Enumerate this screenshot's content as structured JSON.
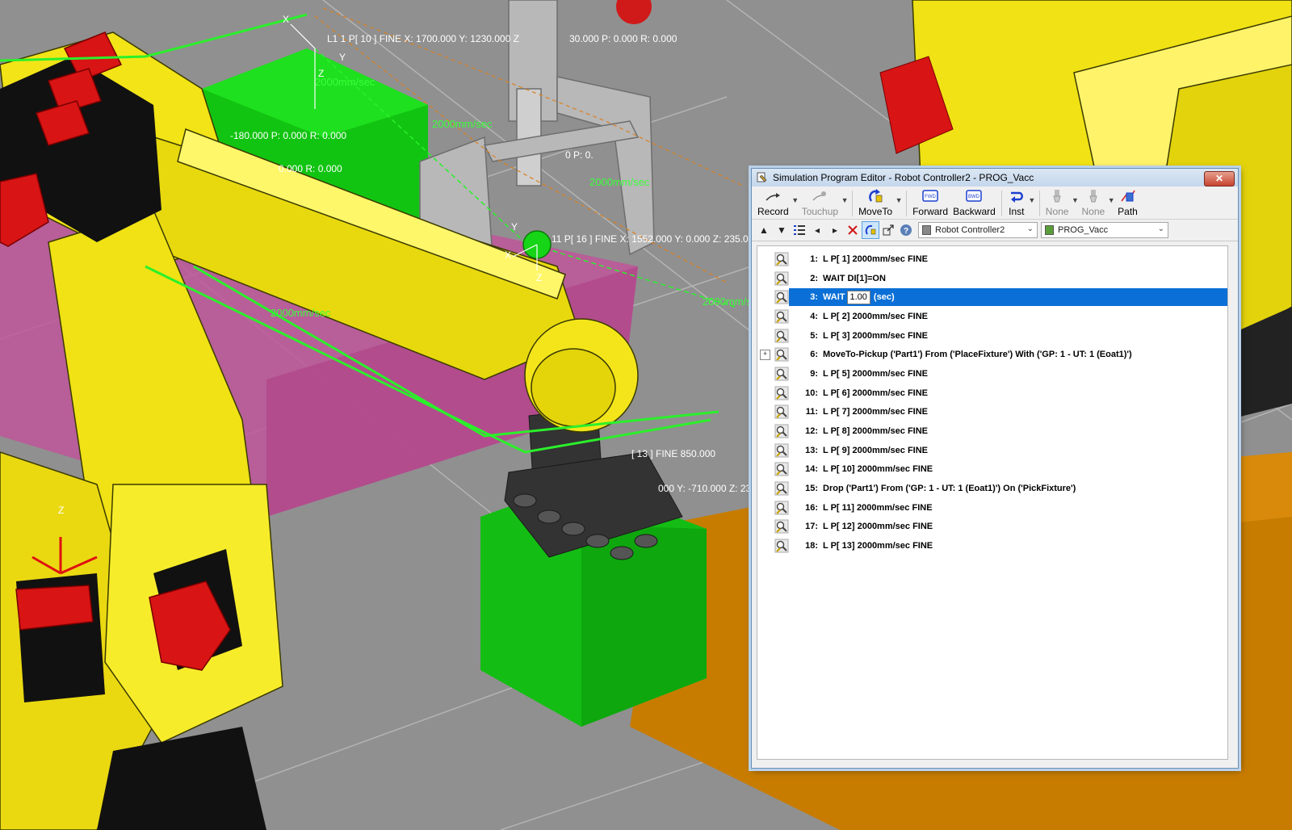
{
  "scene": {
    "labels": {
      "top_left_pose": "L1 1 P[ 10 ]   FINE X: 1700.000 Y: 1230.000 Z",
      "top_right_pose": "30.000 P: 0.000 R: 0.000",
      "mid_pose_1": "-180.000 P: 0.000 R: 0.000",
      "mid_pose_2": "0.000 R: 0.000",
      "mid_pose_3": "0 P: 0.",
      "speed_1": "2000mm/sec",
      "speed_2": "2000mm/sec",
      "speed_3": "2000mm/sec",
      "speed_4": "2000mm/sec",
      "speed_5": "2000mm/sec",
      "target_pose": "11 P[ 16 ] FINE X: 1552.000 Y: 0.000 Z: 235.000",
      "right_pose": "[ 13 ] FINE 850.000",
      "lower_pose": "000 Y: -710.000 Z: 23",
      "axis_x": "X",
      "axis_y": "Y",
      "axis_z": "Z"
    }
  },
  "editor": {
    "title": "Simulation Program Editor - Robot Controller2 - PROG_Vacc",
    "close_label": "✕",
    "toolbar": {
      "record": "Record",
      "touchup": "Touchup",
      "moveto": "MoveTo",
      "forward": "Forward",
      "backward": "Backward",
      "inst": "Inst",
      "none1": "None",
      "none2": "None",
      "path": "Path"
    },
    "controller_select": "Robot Controller2",
    "program_select": "PROG_Vacc",
    "lines": [
      {
        "num": "1:",
        "text": "L P[ 1] 2000mm/sec FINE"
      },
      {
        "num": "2:",
        "text": "WAIT DI[1]=ON"
      },
      {
        "num": "3:",
        "pre": "WAIT",
        "value": "1.00",
        "post": "(sec)"
      },
      {
        "num": "4:",
        "text": "L P[ 2] 2000mm/sec FINE"
      },
      {
        "num": "5:",
        "text": "L P[ 3] 2000mm/sec FINE"
      },
      {
        "num": "6:",
        "text": "MoveTo-Pickup ('Part1') From ('PlaceFixture') With ('GP: 1 - UT: 1  (Eoat1)')"
      },
      {
        "num": "9:",
        "text": "L P[ 5] 2000mm/sec FINE"
      },
      {
        "num": "10:",
        "text": "L P[ 6] 2000mm/sec FINE"
      },
      {
        "num": "11:",
        "text": "L P[ 7] 2000mm/sec FINE"
      },
      {
        "num": "12:",
        "text": "L P[ 8] 2000mm/sec FINE"
      },
      {
        "num": "13:",
        "text": "L P[ 9] 2000mm/sec FINE"
      },
      {
        "num": "14:",
        "text": "L P[ 10] 2000mm/sec FINE"
      },
      {
        "num": "15:",
        "text": "Drop ('Part1') From ('GP: 1 - UT: 1  (Eoat1)') On ('PickFixture')"
      },
      {
        "num": "16:",
        "text": "L P[ 11] 2000mm/sec FINE"
      },
      {
        "num": "17:",
        "text": "L P[ 12] 2000mm/sec FINE"
      },
      {
        "num": "18:",
        "text": "L P[ 13] 2000mm/sec FINE"
      }
    ],
    "expander_symbol": "+"
  }
}
